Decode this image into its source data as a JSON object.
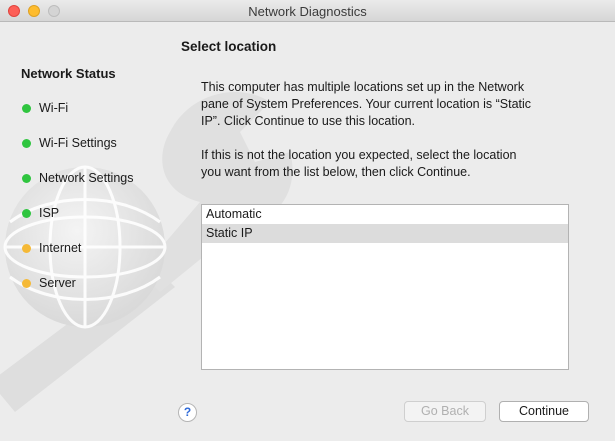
{
  "window": {
    "title": "Network Diagnostics"
  },
  "sidebar": {
    "heading": "Network Status",
    "items": [
      {
        "label": "Wi-Fi",
        "status_color": "#2fc53f"
      },
      {
        "label": "Wi-Fi Settings",
        "status_color": "#2fc53f"
      },
      {
        "label": "Network Settings",
        "status_color": "#2fc53f"
      },
      {
        "label": "ISP",
        "status_color": "#2fc53f"
      },
      {
        "label": "Internet",
        "status_color": "#f5b936"
      },
      {
        "label": "Server",
        "status_color": "#f5b936"
      }
    ]
  },
  "main": {
    "heading": "Select location",
    "paragraph1": [
      "This computer has multiple locations set up in the Network",
      "pane of System Preferences. Your current location is “Static",
      "IP”. Click Continue to use this location."
    ],
    "paragraph2": [
      "If this is not the location you expected, select the location",
      "you want from the list below, then click Continue."
    ],
    "locations": [
      "Automatic",
      "Static IP"
    ],
    "selected_location": "Static IP"
  },
  "footer": {
    "help_label": "?",
    "back_label": "Go Back",
    "continue_label": "Continue"
  }
}
